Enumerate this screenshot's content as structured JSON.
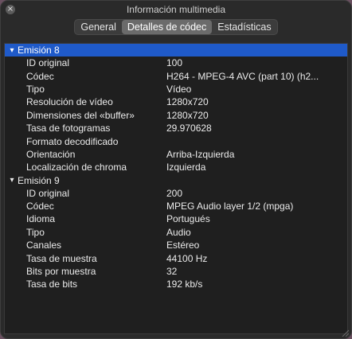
{
  "window": {
    "title": "Información multimedia",
    "close_glyph": "×"
  },
  "tabs": [
    {
      "label": "General",
      "active": false
    },
    {
      "label": "Detalles de códec",
      "active": true
    },
    {
      "label": "Estadísticas",
      "active": false
    }
  ],
  "streams": [
    {
      "header": "Emisión 8",
      "selected": true,
      "expanded": true,
      "rows": [
        {
          "key": "ID original",
          "value": "100"
        },
        {
          "key": "Códec",
          "value": "H264 - MPEG-4 AVC (part 10) (h2..."
        },
        {
          "key": "Tipo",
          "value": "Vídeo"
        },
        {
          "key": "Resolución de vídeo",
          "value": "1280x720"
        },
        {
          "key": "Dimensiones del «buffer»",
          "value": "1280x720"
        },
        {
          "key": "Tasa de fotogramas",
          "value": "29.970628"
        },
        {
          "key": "Formato decodificado",
          "value": ""
        },
        {
          "key": "Orientación",
          "value": "Arriba-Izquierda"
        },
        {
          "key": "Localización de chroma",
          "value": "Izquierda"
        }
      ]
    },
    {
      "header": "Emisión 9",
      "selected": false,
      "expanded": true,
      "rows": [
        {
          "key": "ID original",
          "value": "200"
        },
        {
          "key": "Códec",
          "value": "MPEG Audio layer 1/2 (mpga)"
        },
        {
          "key": "Idioma",
          "value": "Portugués"
        },
        {
          "key": "Tipo",
          "value": "Audio"
        },
        {
          "key": "Canales",
          "value": "Estéreo"
        },
        {
          "key": "Tasa de muestra",
          "value": "44100 Hz"
        },
        {
          "key": "Bits por muestra",
          "value": "32"
        },
        {
          "key": "Tasa de bits",
          "value": "192 kb/s"
        }
      ]
    }
  ],
  "colors": {
    "selection": "#1f5ac9",
    "panel_bg": "#1f1f1f",
    "window_bg": "#2a2a2a"
  },
  "icons": {
    "close": "close-icon",
    "expanded": "chevron-down-icon",
    "resize": "resize-grip-icon"
  }
}
